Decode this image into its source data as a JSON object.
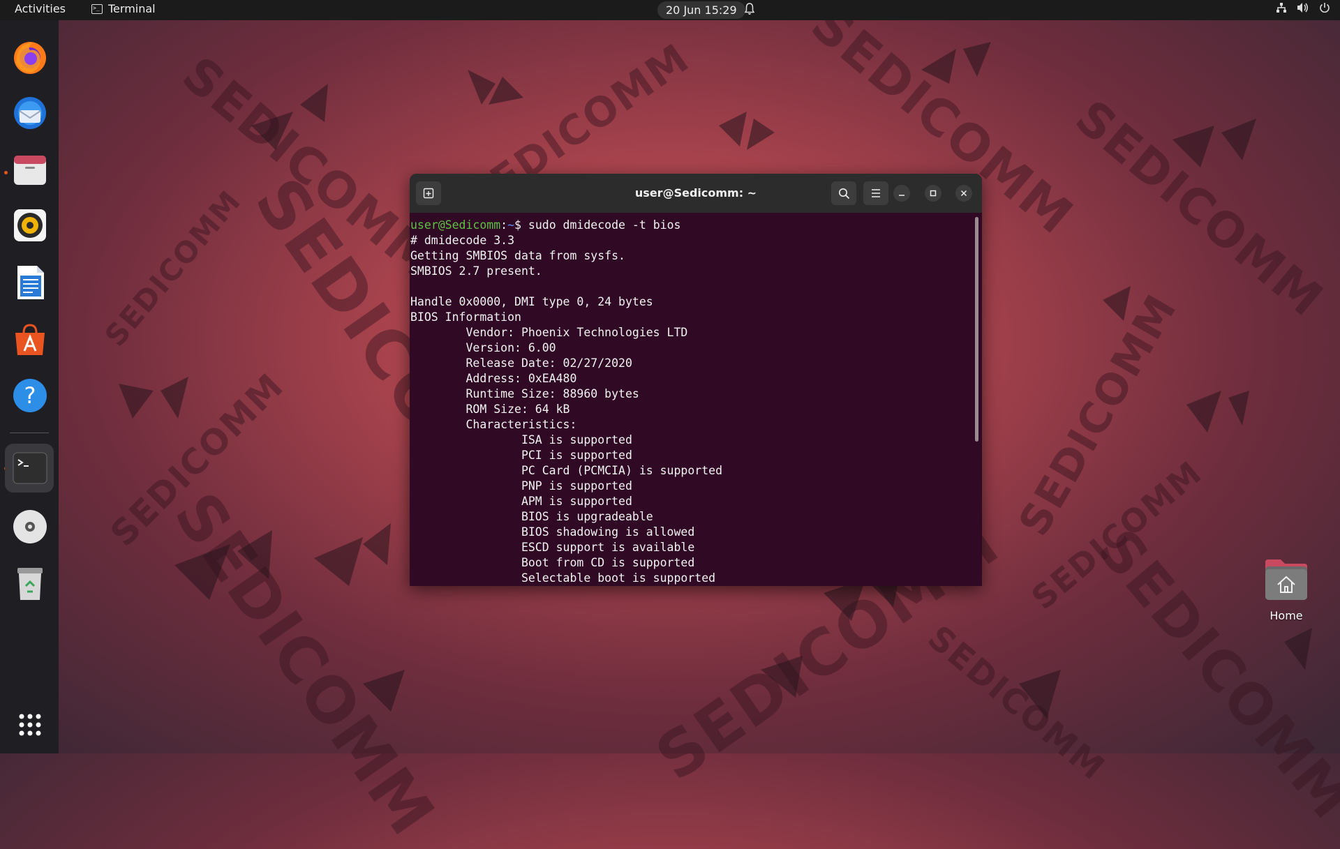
{
  "topbar": {
    "activities": "Activities",
    "app_name": "Terminal",
    "app_icon": "terminal-icon",
    "clock": "20 Jun  15:29",
    "tray_icons": [
      "network-icon",
      "volume-icon",
      "power-icon"
    ]
  },
  "dock": {
    "items": [
      {
        "name": "Firefox",
        "icon": "firefox-icon",
        "running": false
      },
      {
        "name": "Thunderbird",
        "icon": "thunderbird-icon",
        "running": false
      },
      {
        "name": "Files",
        "icon": "files-icon",
        "running": true
      },
      {
        "name": "Rhythmbox",
        "icon": "rhythmbox-icon",
        "running": false
      },
      {
        "name": "LibreOffice Writer",
        "icon": "writer-icon",
        "running": false
      },
      {
        "name": "Ubuntu Software",
        "icon": "software-icon",
        "running": false
      },
      {
        "name": "Help",
        "icon": "help-icon",
        "running": false
      },
      {
        "name": "Terminal",
        "icon": "terminal-icon",
        "running": true
      },
      {
        "name": "Disc",
        "icon": "disc-icon",
        "running": false
      },
      {
        "name": "Trash",
        "icon": "trash-icon",
        "running": false
      },
      {
        "name": "Show Applications",
        "icon": "app-grid-icon",
        "running": false
      }
    ]
  },
  "terminal": {
    "title": "user@Sedicomm: ~",
    "prompt_user": "user@Sedicomm",
    "prompt_sep": ":",
    "prompt_path": "~",
    "prompt_end": "$ ",
    "command": "sudo dmidecode -t bios",
    "output": [
      "# dmidecode 3.3",
      "Getting SMBIOS data from sysfs.",
      "SMBIOS 2.7 present.",
      "",
      "Handle 0x0000, DMI type 0, 24 bytes",
      "BIOS Information",
      "        Vendor: Phoenix Technologies LTD",
      "        Version: 6.00",
      "        Release Date: 02/27/2020",
      "        Address: 0xEA480",
      "        Runtime Size: 88960 bytes",
      "        ROM Size: 64 kB",
      "        Characteristics:",
      "                ISA is supported",
      "                PCI is supported",
      "                PC Card (PCMCIA) is supported",
      "                PNP is supported",
      "                APM is supported",
      "                BIOS is upgradeable",
      "                BIOS shadowing is allowed",
      "                ESCD support is available",
      "                Boot from CD is supported",
      "                Selectable boot is supported"
    ]
  },
  "desktop": {
    "home_label": "Home"
  },
  "wallpaper": {
    "watermark": "SEDICOMM"
  }
}
